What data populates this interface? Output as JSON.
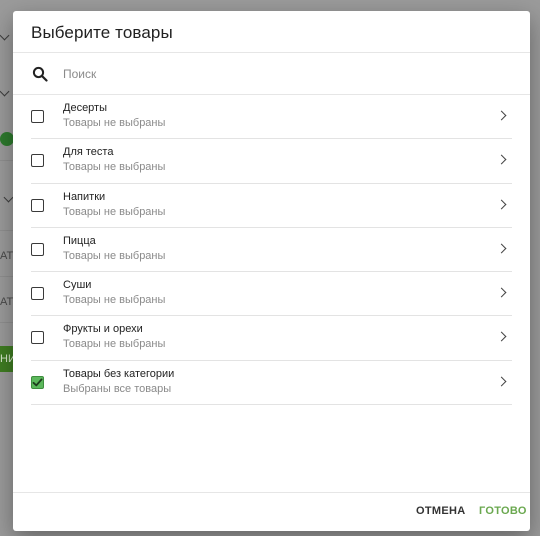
{
  "background": {
    "fragments": [
      "АТ",
      "АТ",
      "НИ"
    ]
  },
  "dialog": {
    "title": "Выберите товары",
    "search": {
      "placeholder": "Поиск",
      "value": ""
    },
    "items": [
      {
        "name": "Десерты",
        "status": "Товары не выбраны",
        "checked": false
      },
      {
        "name": "Для теста",
        "status": "Товары не выбраны",
        "checked": false
      },
      {
        "name": "Напитки",
        "status": "Товары не выбраны",
        "checked": false
      },
      {
        "name": "Пицца",
        "status": "Товары не выбраны",
        "checked": false
      },
      {
        "name": "Суши",
        "status": "Товары не выбраны",
        "checked": false
      },
      {
        "name": "Фрукты и орехи",
        "status": "Товары не выбраны",
        "checked": false
      },
      {
        "name": "Товары без категории",
        "status": "Выбраны все товары",
        "checked": true
      }
    ],
    "footer": {
      "cancel_label": "ОТМЕНА",
      "done_label": "ГОТОВО"
    },
    "colors": {
      "accent": "#6aa84f",
      "checkbox_checked": "#5cb85c"
    }
  }
}
